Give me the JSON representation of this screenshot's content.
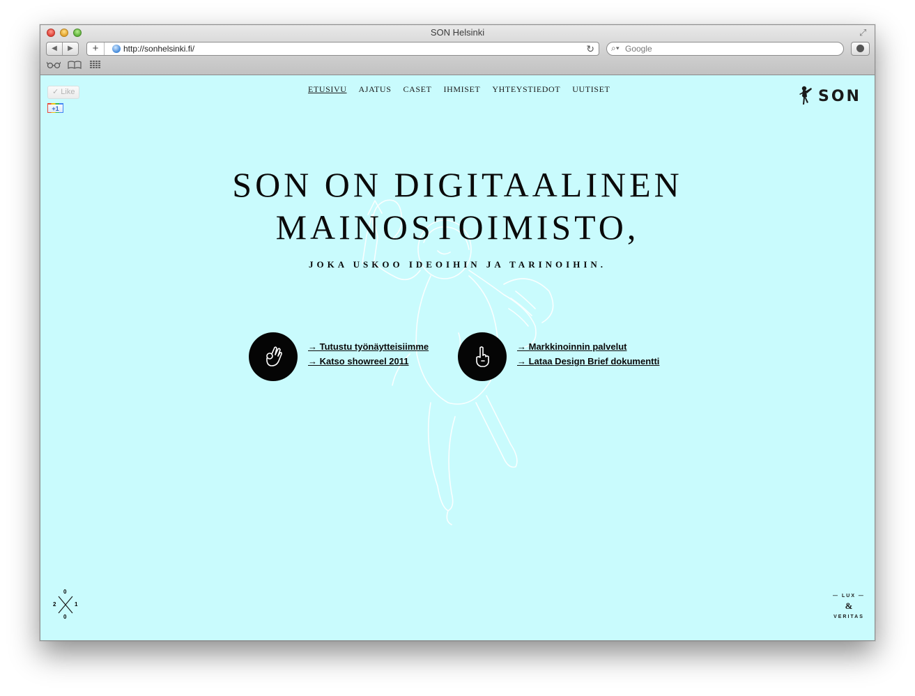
{
  "window": {
    "title": "SON Helsinki"
  },
  "toolbar": {
    "url": "http://sonhelsinki.fi/",
    "search_placeholder": "Google"
  },
  "social": {
    "like_label": "Like",
    "plusone_label": "+1"
  },
  "nav": {
    "items": [
      "ETUSIVU",
      "AJATUS",
      "CASET",
      "IHMISET",
      "YHTEYSTIEDOT",
      "UUTISET"
    ],
    "active": "ETUSIVU"
  },
  "logo": {
    "text": "SON"
  },
  "hero": {
    "headline_line1": "SON ON DIGITAALINEN",
    "headline_line2": "MAINOSTOIMISTO,",
    "subline": "JOKA USKOO IDEOIHIN JA TARINOIHIN."
  },
  "cta": {
    "left": {
      "icon": "ok-hand-icon",
      "links": [
        "→ Tutustu työnäytteisiimme",
        "→ Katso showreel 2011"
      ]
    },
    "right": {
      "icon": "pointing-finger-icon",
      "links": [
        "→ Markkinoinnin palvelut",
        "→ Lataa Design Brief dokumentti"
      ]
    }
  },
  "footer": {
    "year_mark": {
      "top": "0",
      "left": "2",
      "right": "1",
      "bottom": "0"
    },
    "motto": {
      "top": "— LUX —",
      "middle": "&",
      "bottom": "VERITAS"
    }
  },
  "colors": {
    "page_background": "#c9fbfd",
    "text": "#0a0a0a"
  }
}
